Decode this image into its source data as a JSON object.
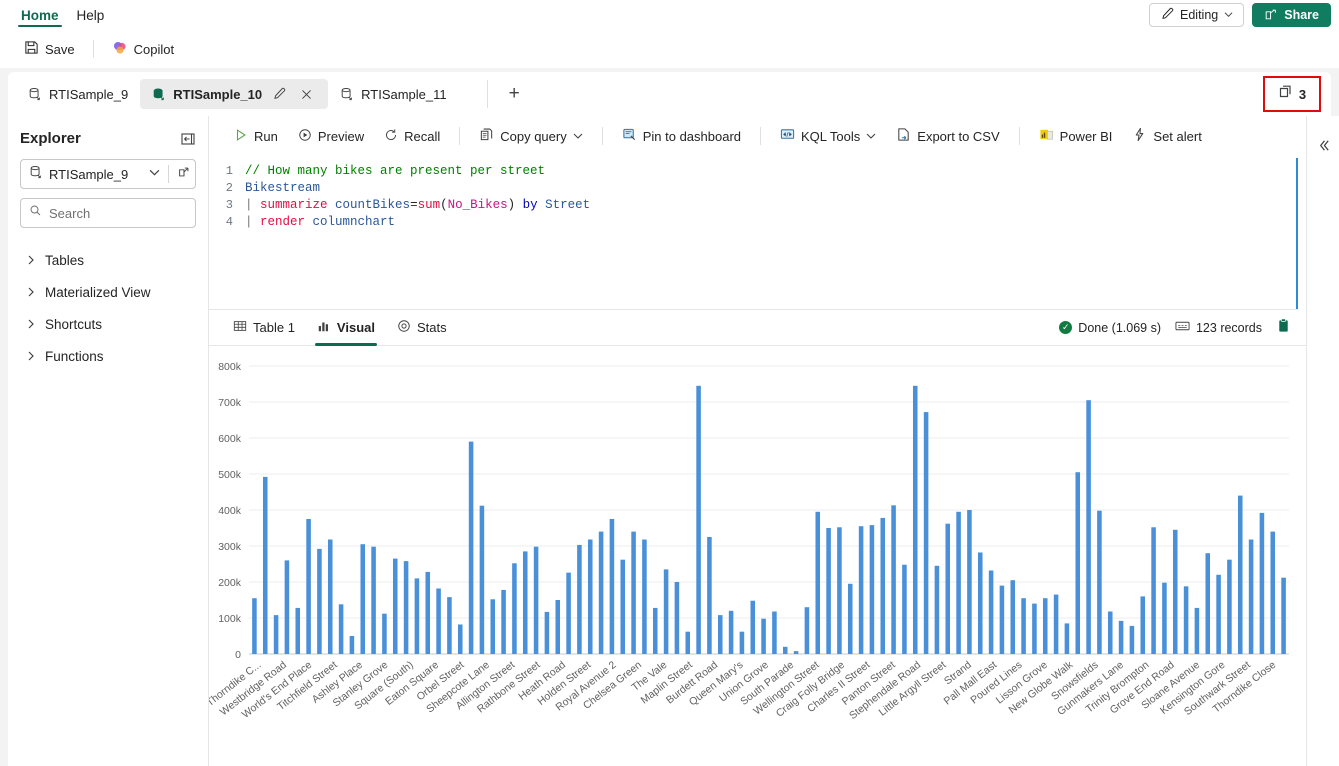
{
  "ribbon": {
    "tabs": [
      {
        "label": "Home",
        "active": true
      },
      {
        "label": "Help",
        "active": false
      }
    ],
    "editing_label": "Editing",
    "share_label": "Share"
  },
  "commandbar": {
    "items": [
      {
        "label": "Save",
        "icon": "save-icon"
      },
      {
        "label": "Copilot",
        "icon": "copilot-icon"
      }
    ]
  },
  "tabstrip": {
    "tabs": [
      {
        "label": "RTISample_9",
        "active": false
      },
      {
        "label": "RTISample_10",
        "active": true
      },
      {
        "label": "RTISample_11",
        "active": false
      }
    ],
    "add_label": "+",
    "tab_count": "3"
  },
  "explorer": {
    "title": "Explorer",
    "database": "RTISample_9",
    "search_placeholder": "Search",
    "search_value": "",
    "tree": [
      {
        "label": "Tables"
      },
      {
        "label": "Materialized View"
      },
      {
        "label": "Shortcuts"
      },
      {
        "label": "Functions"
      }
    ]
  },
  "query_toolbar": {
    "items": [
      {
        "label": "Run",
        "icon": "play-icon",
        "chevron": false
      },
      {
        "label": "Preview",
        "icon": "preview-icon",
        "chevron": false
      },
      {
        "label": "Recall",
        "icon": "recall-icon",
        "chevron": false
      },
      {
        "label": "Copy query",
        "icon": "copy-icon",
        "chevron": true
      },
      {
        "label": "Pin to dashboard",
        "icon": "pin-dashboard-icon",
        "chevron": false
      },
      {
        "label": "KQL Tools",
        "icon": "kql-tools-icon",
        "chevron": true
      },
      {
        "label": "Export to CSV",
        "icon": "export-csv-icon",
        "chevron": false
      },
      {
        "label": "Power BI",
        "icon": "power-bi-icon",
        "chevron": false
      },
      {
        "label": "Set alert",
        "icon": "set-alert-icon",
        "chevron": false
      }
    ]
  },
  "editor": {
    "lines": [
      {
        "num": "1",
        "text": "// How many bikes are present per street"
      },
      {
        "num": "2",
        "text": "Bikestream"
      },
      {
        "num": "3",
        "text": "| summarize countBikes=sum(No_Bikes) by Street"
      },
      {
        "num": "4",
        "text": "| render columnchart"
      }
    ]
  },
  "results": {
    "tabs": [
      {
        "label": "Table 1",
        "icon": "table-icon",
        "active": false
      },
      {
        "label": "Visual",
        "icon": "chart-icon",
        "active": true
      },
      {
        "label": "Stats",
        "icon": "stats-icon",
        "active": false
      }
    ],
    "status": "Done (1.069 s)",
    "records": "123 records",
    "clipboard_icon": "clipboard-icon",
    "collapse_icon": "chevron-up-icon"
  },
  "colors": {
    "accent_green": "#107c60",
    "bar_blue": "#4a90d9",
    "highlight_red": "#e00b0b",
    "tab_underline": "#0f6b4f"
  },
  "chart_data": {
    "type": "bar",
    "title": "",
    "xlabel": "",
    "ylabel": "",
    "ylim": [
      0,
      800000
    ],
    "ytick_labels": [
      "0",
      "100k",
      "200k",
      "300k",
      "400k",
      "500k",
      "600k",
      "700k",
      "800k"
    ],
    "ytick_values": [
      0,
      100000,
      200000,
      300000,
      400000,
      500000,
      600000,
      700000,
      800000
    ],
    "grid": true,
    "legend": "none",
    "categories": [
      "Thorndike C...",
      "Westbridge Road",
      "World's End Place",
      "Titchfield Street",
      "Ashley Place",
      "Stanley Grove",
      "Square (South)",
      "Eaton Square",
      "Orbel Street",
      "Sheepcote Lane",
      "Allington Street",
      "Rathbone Street",
      "Heath Road",
      "Holden Street",
      "Royal Avenue 2",
      "Chelsea Green",
      "The Vale",
      "Maplin Street",
      "Burdett Road",
      "Queen Mary's",
      "Union Grove",
      "South Parade",
      "Wellington Street",
      "Craig Folly Bridge",
      "Charles II Street",
      "Panton Street",
      "Stephendale Road",
      "Little Argyll Street",
      "Strand",
      "Pall Mall East",
      "Poured Lines",
      "Lisson Grove",
      "New Globe Walk",
      "Snowsfields",
      "Gunmakers Lane",
      "Trinity Brompton",
      "Grove End Road",
      "Sloane Avenue",
      "Kensington Gore",
      "Southwark Street",
      "Thorndike Close"
    ],
    "values": [
      155000,
      492000,
      108000,
      260000,
      128000,
      375000,
      292000,
      318000,
      138000,
      50000,
      305000,
      298000,
      112000,
      265000,
      258000,
      210000,
      228000,
      182000,
      158000,
      82000,
      590000,
      412000,
      152000,
      178000,
      252000,
      285000,
      298000,
      117000,
      150000,
      226000,
      303000,
      318000,
      340000,
      375000,
      262000,
      340000,
      318000,
      128000,
      235000,
      200000,
      62000,
      745000,
      325000,
      108000,
      120000,
      62000,
      148000,
      98000,
      118000,
      20000,
      8000,
      130000,
      395000,
      350000,
      352000,
      195000,
      355000,
      358000,
      378000,
      413000,
      248000,
      745000,
      672000,
      245000,
      362000,
      395000,
      400000,
      282000,
      232000,
      190000,
      205000,
      155000,
      140000,
      155000,
      165000,
      85000,
      505000,
      705000,
      398000,
      118000,
      92000,
      78000,
      160000,
      352000,
      198000,
      345000,
      188000,
      128000,
      280000,
      220000,
      262000,
      440000,
      318000,
      392000,
      340000,
      212000
    ],
    "value_label_format": "k"
  }
}
